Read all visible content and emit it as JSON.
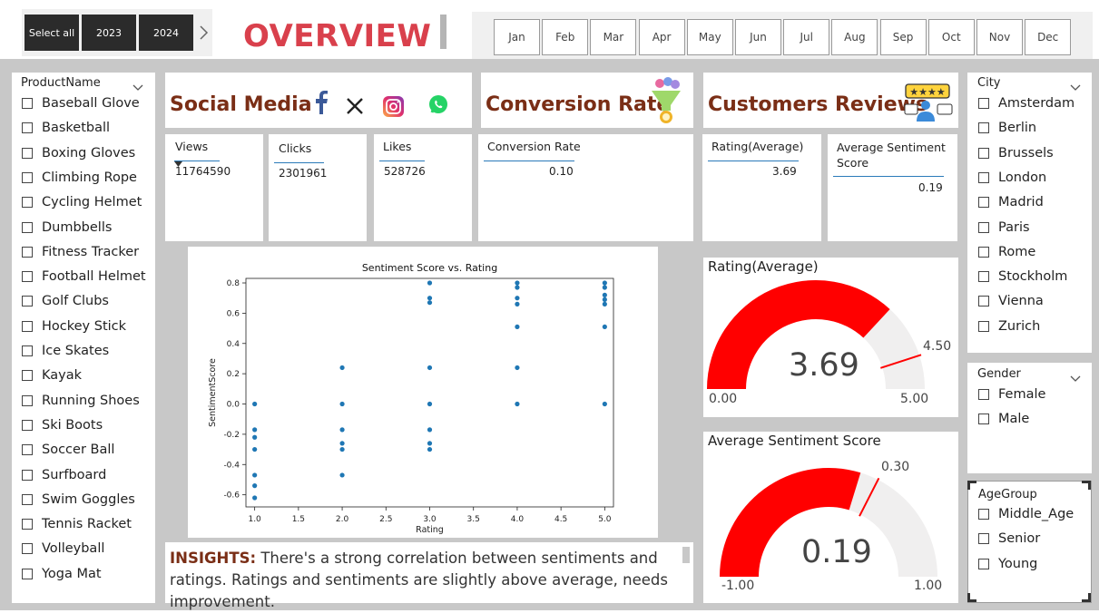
{
  "header": {
    "title": "OVERVIEW",
    "year_buttons": [
      "Select all",
      "2023",
      "2024"
    ],
    "months": [
      "Jan",
      "Feb",
      "Mar",
      "Apr",
      "May",
      "Jun",
      "Jul",
      "Aug",
      "Sep",
      "Oct",
      "Nov",
      "Dec"
    ]
  },
  "product_slicer": {
    "title": "ProductName",
    "items": [
      "Baseball Glove",
      "Basketball",
      "Boxing Gloves",
      "Climbing Rope",
      "Cycling Helmet",
      "Dumbbells",
      "Fitness Tracker",
      "Football Helmet",
      "Golf Clubs",
      "Hockey Stick",
      "Ice Skates",
      "Kayak",
      "Running Shoes",
      "Ski Boots",
      "Soccer Ball",
      "Surfboard",
      "Swim Goggles",
      "Tennis Racket",
      "Volleyball",
      "Yoga Mat"
    ]
  },
  "city_slicer": {
    "title": "City",
    "items": [
      "Amsterdam",
      "Berlin",
      "Brussels",
      "London",
      "Madrid",
      "Paris",
      "Rome",
      "Stockholm",
      "Vienna",
      "Zurich"
    ]
  },
  "gender_slicer": {
    "title": "Gender",
    "items": [
      "Female",
      "Male"
    ]
  },
  "agegroup_slicer": {
    "title": "AgeGroup",
    "items": [
      "Middle_Age",
      "Senior",
      "Young"
    ]
  },
  "social_media": {
    "title": "Social Media",
    "icons": [
      "facebook-icon",
      "x-icon",
      "instagram-icon",
      "whatsapp-icon"
    ],
    "views_label": "Views",
    "views_value": "11764590",
    "clicks_label": "Clicks",
    "clicks_value": "2301961",
    "likes_label": "Likes",
    "likes_value": "528726"
  },
  "conversion": {
    "title": "Conversion Rate",
    "label": "Conversion Rate",
    "value": "0.10"
  },
  "reviews": {
    "title": "Customers Reviews",
    "rating_label": "Rating(Average)",
    "rating_value": "3.69",
    "sentiment_label": "Average Sentiment Score",
    "sentiment_value": "0.19"
  },
  "gauge_rating": {
    "title": "Rating(Average)",
    "value_text": "3.69",
    "min_text": "0.00",
    "max_text": "5.00",
    "target_text": "4.50",
    "value": 3.69,
    "min": 0,
    "max": 5,
    "target": 4.5,
    "fill_color": "#ff0000",
    "track_color": "#f0efef",
    "target_color": "#ff0000"
  },
  "gauge_sentiment": {
    "title": "Average Sentiment Score",
    "value_text": "0.19",
    "min_text": "-1.00",
    "max_text": "1.00",
    "target_text": "0.30",
    "value": 0.19,
    "min": -1,
    "max": 1,
    "target": 0.3,
    "fill_color": "#ff0000",
    "track_color": "#f0efef",
    "target_color": "#ff0000"
  },
  "insights": {
    "prefix": "INSIGHTS:",
    "text": "There's a strong correlation between sentiments and ratings. Ratings and sentiments are slightly above average, needs improvement."
  },
  "chart_data": {
    "type": "scatter",
    "title": "Sentiment Score vs. Rating",
    "xlabel": "Rating",
    "ylabel": "SentimentScore",
    "xlim": [
      0.9,
      5.1
    ],
    "ylim": [
      -0.68,
      0.83
    ],
    "xticks": [
      "1.0",
      "1.5",
      "2.0",
      "2.5",
      "3.0",
      "3.5",
      "4.0",
      "4.5",
      "5.0"
    ],
    "yticks": [
      "-0.6",
      "-0.4",
      "-0.2",
      "0.0",
      "0.2",
      "0.4",
      "0.6",
      "0.8"
    ],
    "point_color": "#1f77b4",
    "points": [
      [
        1,
        0
      ],
      [
        1,
        -0.17
      ],
      [
        1,
        -0.22
      ],
      [
        1,
        -0.3
      ],
      [
        1,
        -0.47
      ],
      [
        1,
        -0.54
      ],
      [
        1,
        -0.62
      ],
      [
        2,
        0.24
      ],
      [
        2,
        0
      ],
      [
        2,
        -0.17
      ],
      [
        2,
        -0.26
      ],
      [
        2,
        -0.3
      ],
      [
        2,
        -0.47
      ],
      [
        3,
        0.8
      ],
      [
        3,
        0.7
      ],
      [
        3,
        0.67
      ],
      [
        3,
        0.24
      ],
      [
        3,
        0
      ],
      [
        3,
        -0.17
      ],
      [
        3,
        -0.26
      ],
      [
        3,
        -0.3
      ],
      [
        4,
        0.8
      ],
      [
        4,
        0.77
      ],
      [
        4,
        0.7
      ],
      [
        4,
        0.66
      ],
      [
        4,
        0.51
      ],
      [
        4,
        0.24
      ],
      [
        4,
        0
      ],
      [
        5,
        0.8
      ],
      [
        5,
        0.77
      ],
      [
        5,
        0.72
      ],
      [
        5,
        0.69
      ],
      [
        5,
        0.66
      ],
      [
        5,
        0.51
      ],
      [
        5,
        0
      ]
    ]
  }
}
